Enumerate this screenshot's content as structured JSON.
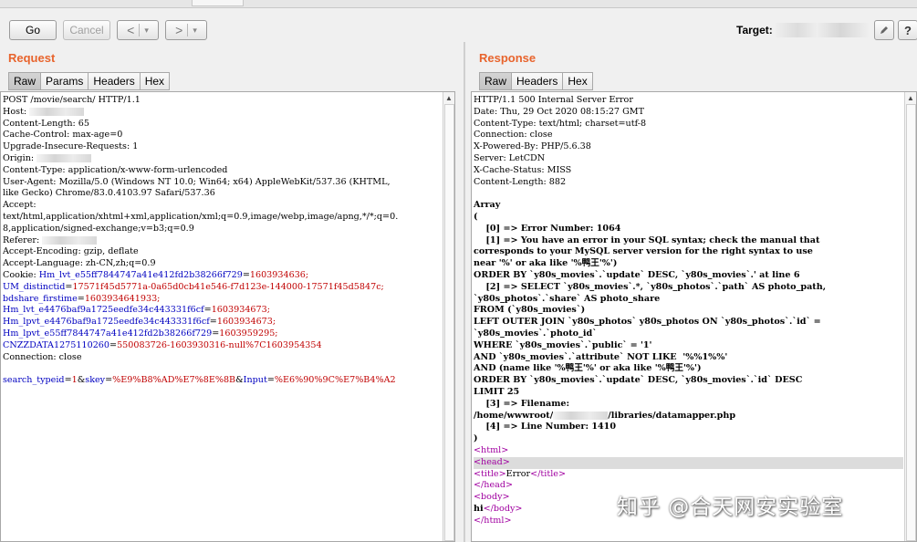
{
  "toolbar": {
    "go": "Go",
    "cancel": "Cancel",
    "back": "<",
    "forward": ">",
    "dropdown": "▾",
    "target_label": "Target:"
  },
  "request": {
    "title": "Request",
    "tabs": [
      "Raw",
      "Params",
      "Headers",
      "Hex"
    ],
    "lines": [
      {
        "t": "POST /movie/search/ HTTP/1.1"
      },
      {
        "t": "Host: ",
        "redact": true
      },
      {
        "t": "Content-Length: 65"
      },
      {
        "t": "Cache-Control: max-age=0"
      },
      {
        "t": "Upgrade-Insecure-Requests: 1"
      },
      {
        "t": "Origin: ",
        "redact": true
      },
      {
        "t": "Content-Type: application/x-www-form-urlencoded"
      },
      {
        "t": "User-Agent: Mozilla/5.0 (Windows NT 10.0; Win64; x64) AppleWebKit/537.36 (KHTML,"
      },
      {
        "t": "like Gecko) Chrome/83.0.4103.97 Safari/537.36"
      },
      {
        "t": "Accept:"
      },
      {
        "t": "text/html,application/xhtml+xml,application/xml;q=0.9,image/webp,image/apng,*/*;q=0."
      },
      {
        "t": "8,application/signed-exchange;v=b3;q=0.9"
      },
      {
        "t": "Referer: ",
        "redact": true
      },
      {
        "t": "Accept-Encoding: gzip, deflate"
      },
      {
        "t": "Accept-Language: zh-CN,zh;q=0.9"
      },
      {
        "k": "Cookie: ",
        "kv": "Hm_lvt_e55ff7844747a41e412fd2b38266f729",
        "eq": "=",
        "v": "1603934636;"
      },
      {
        "kv": "UM_distinctid",
        "eq": "=",
        "v": "17571f45d5771a-0a65d0cb41e546-f7d123e-144000-17571f45d5847c;"
      },
      {
        "kv": "bdshare_firstime",
        "eq": "=",
        "v": "1603934641933;"
      },
      {
        "kv": "Hm_lvt_e4476baf9a1725eedfe34c443331f6cf",
        "eq": "=",
        "v": "1603934673;"
      },
      {
        "kv": "Hm_lpvt_e4476baf9a1725eedfe34c443331f6cf",
        "eq": "=",
        "v": "1603934673;"
      },
      {
        "kv": "Hm_lpvt_e55ff7844747a41e412fd2b38266f729",
        "eq": "=",
        "v": "1603959295;"
      },
      {
        "kv": "CNZZDATA1275110260",
        "eq": "=",
        "v": "550083726-1603930316-null%7C1603954354"
      },
      {
        "t": "Connection: close"
      },
      {
        "t": ""
      },
      {
        "kv": "search_typeid",
        "eq": "=",
        "v": "1",
        "sep": "&",
        "kv2": "skey",
        "eq2": "=",
        "v2": "%E9%B8%AD%E7%8E%8B",
        "sep2": "&",
        "kv3": "Input",
        "eq3": "=",
        "v3": "%E6%90%9C%E7%B4%A2"
      }
    ]
  },
  "response": {
    "title": "Response",
    "tabs": [
      "Raw",
      "Headers",
      "Hex"
    ],
    "lines": [
      {
        "t": "HTTP/1.1 500 Internal Server Error"
      },
      {
        "t": "Date: Thu, 29 Oct 2020 08:15:27 GMT"
      },
      {
        "t": "Content-Type: text/html; charset=utf-8"
      },
      {
        "t": "Connection: close"
      },
      {
        "t": "X-Powered-By: PHP/5.6.38"
      },
      {
        "t": "Server: LetCDN"
      },
      {
        "t": "X-Cache-Status: MISS"
      },
      {
        "t": "Content-Length: 882"
      },
      {
        "t": ""
      },
      {
        "t": "Array",
        "b": true
      },
      {
        "t": "(",
        "b": true
      },
      {
        "t": "    [0] => Error Number: 1064",
        "b": true
      },
      {
        "t": "    [1] => You have an error in your SQL syntax; check the manual that",
        "b": true
      },
      {
        "t": "corresponds to your MySQL server version for the right syntax to use",
        "b": true
      },
      {
        "t": "near '%' or aka like '%鸭王'%')",
        "b": true
      },
      {
        "t": "ORDER BY `y80s_movies`.`update` DESC, `y80s_movies`.' at line 6",
        "b": true
      },
      {
        "t": "    [2] => SELECT `y80s_movies`.*, `y80s_photos`.`path` AS photo_path,",
        "b": true
      },
      {
        "t": "`y80s_photos`.`share` AS photo_share",
        "b": true
      },
      {
        "t": "FROM (`y80s_movies`)",
        "b": true
      },
      {
        "t": "LEFT OUTER JOIN `y80s_photos` y80s_photos ON `y80s_photos`.`id` =",
        "b": true
      },
      {
        "t": "`y80s_movies`.`photo_id`",
        "b": true
      },
      {
        "t": "WHERE `y80s_movies`.`public` = '1'",
        "b": true
      },
      {
        "t": "AND `y80s_movies`.`attribute` NOT LIKE  '%%1%%'",
        "b": true
      },
      {
        "t": "AND (name like '%鸭王'%' or aka like '%鸭王'%')",
        "b": true
      },
      {
        "t": "ORDER BY `y80s_movies`.`update` DESC, `y80s_movies`.`id` DESC",
        "b": true
      },
      {
        "t": "LIMIT 25",
        "b": true
      },
      {
        "t": "    [3] => Filename:",
        "b": true
      },
      {
        "t": "/home/wwwroot/",
        "redact": true,
        "tail": "/libraries/datamapper.php",
        "b": true
      },
      {
        "t": "    [4] => Line Number: 1410",
        "b": true
      },
      {
        "t": ")",
        "b": true
      },
      {
        "tag": "<html>"
      },
      {
        "tag": "<head>",
        "hl": true
      },
      {
        "tag": "<title>",
        "text": "Error",
        "tag2": "</title>"
      },
      {
        "tag": "</head>"
      },
      {
        "tag": "<body>"
      },
      {
        "text": "hi",
        "tag2": "</body>",
        "bt": true
      },
      {
        "tag": "</html>"
      }
    ]
  },
  "watermark": "知乎 @合天网安实验室"
}
